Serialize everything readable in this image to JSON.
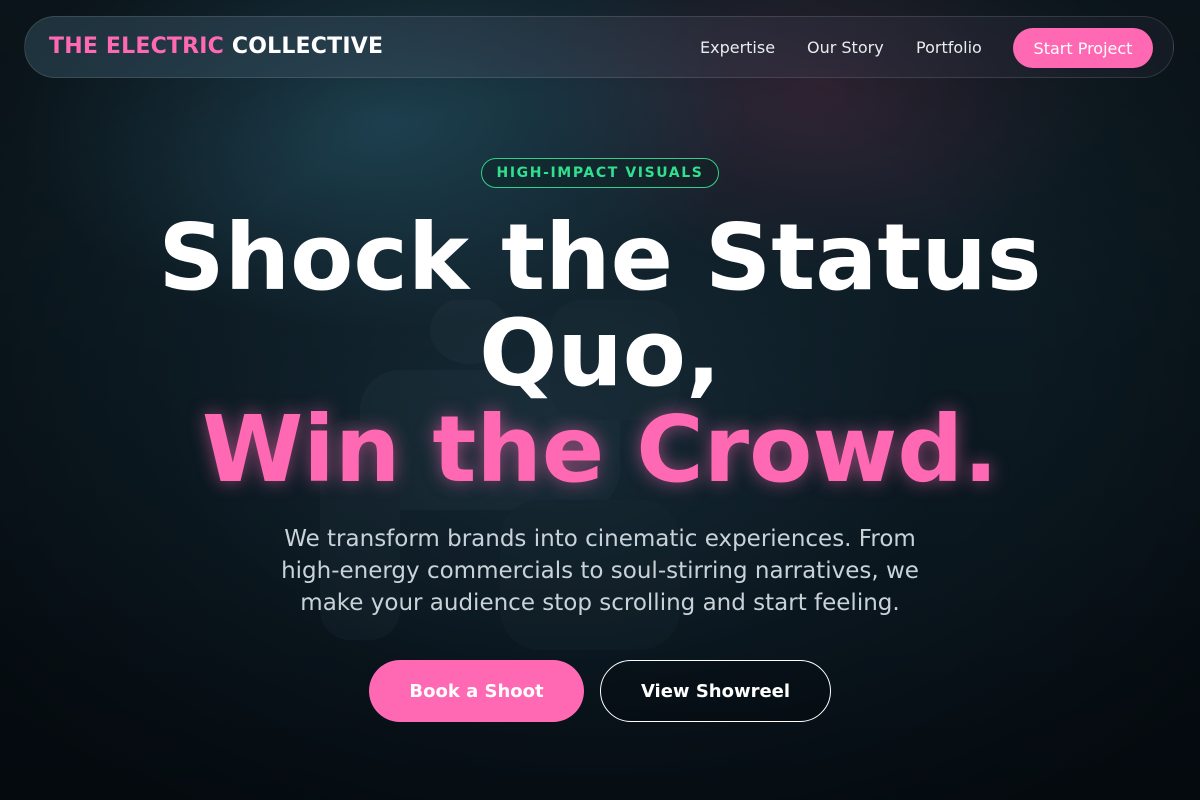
{
  "nav": {
    "brand_accent": "THE ELECTRIC",
    "brand_rest": "COLLECTIVE",
    "links": [
      {
        "label": "Expertise"
      },
      {
        "label": "Our Story"
      },
      {
        "label": "Portfolio"
      }
    ],
    "cta_label": "Start Project"
  },
  "hero": {
    "badge": "HIGH-IMPACT VISUALS",
    "headline_line1": "Shock the Status Quo,",
    "headline_line2": "Win the Crowd.",
    "subtitle": "We transform brands into cinematic experiences. From high-energy commercials to soul-stirring narratives, we make your audience stop scrolling and start feeling.",
    "primary_button": "Book a Shoot",
    "secondary_button": "View Showreel"
  },
  "colors": {
    "accent_pink": "#ff69b4",
    "badge_green": "#2fe08f",
    "background": "#0c1a22"
  }
}
